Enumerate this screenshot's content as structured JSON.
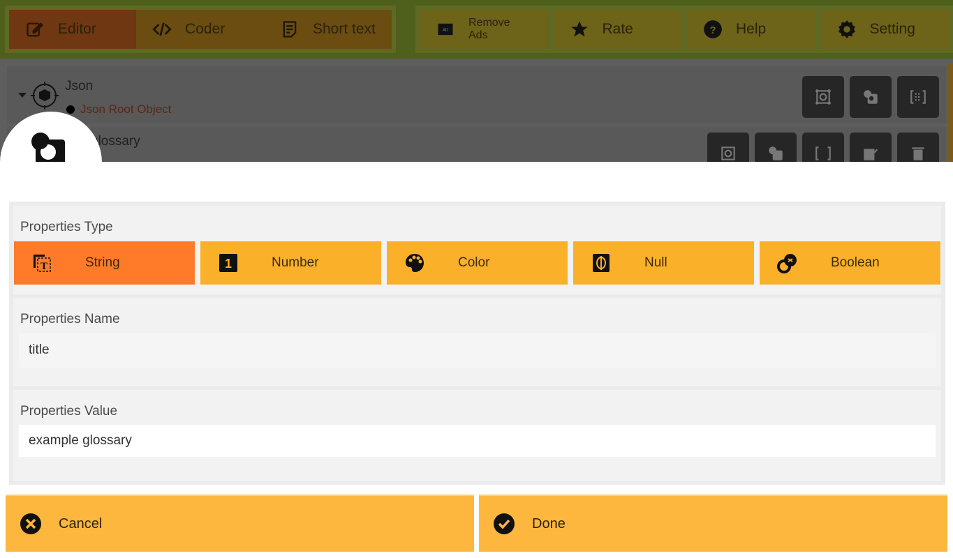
{
  "toolbar": {
    "mode_tabs": [
      {
        "label": "Editor",
        "icon": "edit-icon",
        "active": true
      },
      {
        "label": "Coder",
        "icon": "code-icon",
        "active": false
      },
      {
        "label": "Short text",
        "icon": "note-icon",
        "active": false
      }
    ],
    "actions": [
      {
        "label": "Remove Ads",
        "icon": "ad-icon"
      },
      {
        "label": "Rate",
        "icon": "star-icon"
      },
      {
        "label": "Help",
        "icon": "help-icon"
      },
      {
        "label": "Setting",
        "icon": "gear-icon"
      }
    ]
  },
  "tree": {
    "root": {
      "title": "Json",
      "subtitle": "Json Root Object"
    },
    "child": {
      "title": "glossary",
      "subtitle_visible": "lossary"
    }
  },
  "dialog": {
    "properties_type": {
      "label": "Properties Type",
      "options": [
        {
          "label": "String",
          "icon": "text-type-icon",
          "selected": true
        },
        {
          "label": "Number",
          "icon": "number-icon",
          "selected": false
        },
        {
          "label": "Color",
          "icon": "palette-icon",
          "selected": false
        },
        {
          "label": "Null",
          "icon": "null-icon",
          "selected": false
        },
        {
          "label": "Boolean",
          "icon": "boolean-icon",
          "selected": false
        }
      ]
    },
    "properties_name": {
      "label": "Properties Name",
      "value": "title"
    },
    "properties_value": {
      "label": "Properties Value",
      "value": "example glossary"
    },
    "cancel_label": "Cancel",
    "done_label": "Done"
  },
  "colors": {
    "selected_type": "#ff7b2a",
    "type_button": "#fbb02a",
    "footer_button": "#fdb73f"
  }
}
